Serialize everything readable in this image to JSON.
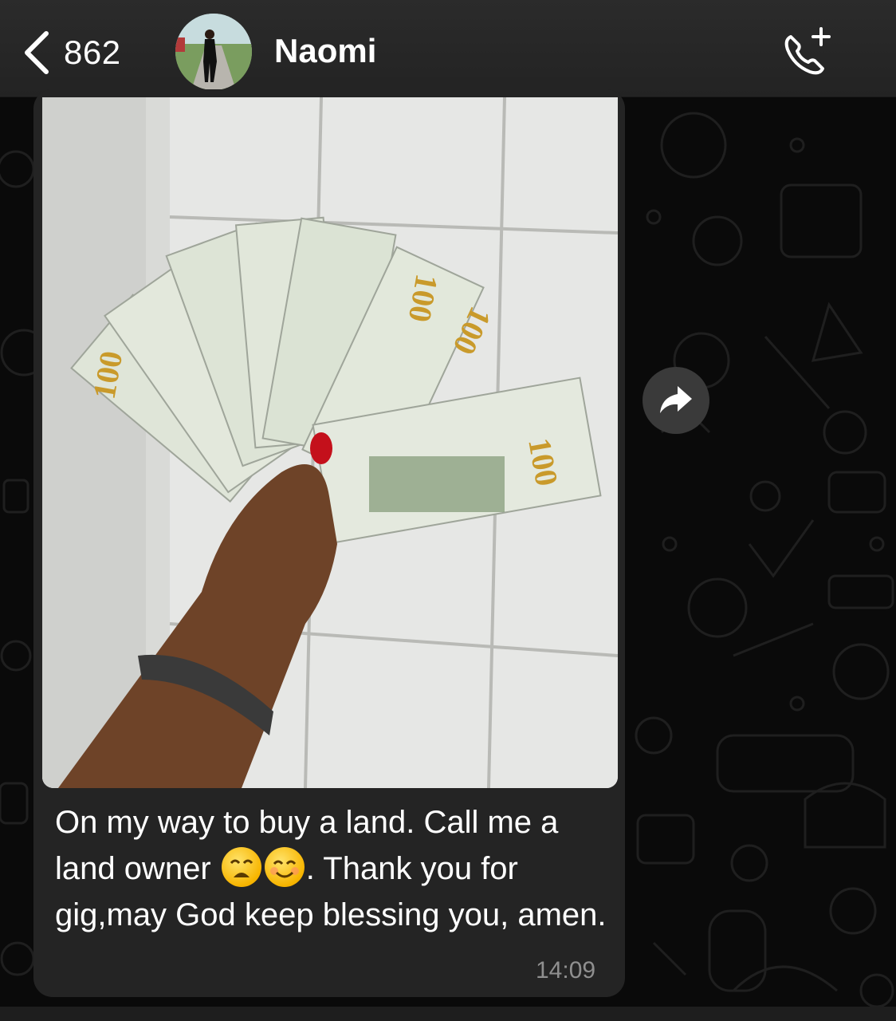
{
  "header": {
    "back_count": "862",
    "contact_name": "Naomi",
    "back_icon": "chevron-left-icon",
    "call_icon": "phone-add-icon"
  },
  "message": {
    "text_part1": "On my way to buy a land. Call me a land owner ",
    "emoji_1": "weary-face",
    "emoji_2": "smiling-face",
    "text_part2": ". Thank you for gig,may God keep blessing you, amen.",
    "time": "14:09",
    "photo_description_icon": "image"
  },
  "colors": {
    "header_bg": "#262626",
    "bubble_bg": "#242424",
    "chat_bg": "#0a0a0a",
    "timestamp": "#8f8f8f"
  }
}
